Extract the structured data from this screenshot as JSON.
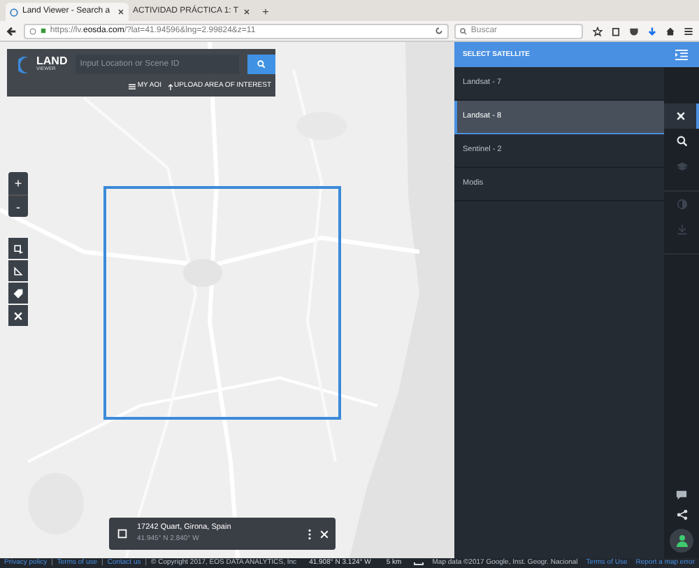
{
  "browser": {
    "tabs": [
      {
        "title": "Land Viewer - Search a",
        "selected": true
      },
      {
        "title": "ACTIVIDAD PRÁCTICA 1: T",
        "selected": false
      }
    ],
    "new_tab": "+",
    "url_prefix": "https://lv.",
    "url_domain": "eosda.com",
    "url_rest": "/?lat=41.94596&lng=2.99824&z=11",
    "search_placeholder": "Buscar"
  },
  "app": {
    "logo": {
      "line1": "LAND",
      "line2": "VIEWER"
    },
    "search": {
      "placeholder": "Input Location or Scene ID"
    },
    "links": [
      "MY AOI",
      "UPLOAD AREA OF INTEREST"
    ]
  },
  "map": {
    "kind": "picture",
    "zoom_in": "+",
    "zoom_out": "-"
  },
  "location_card": {
    "address": "17242 Quart, Girona, Spain",
    "coords": "41.945° N 2.840° W"
  },
  "satellite_panel": {
    "title": "SELECT SATELLITE",
    "items": [
      {
        "label": "Landsat - 7",
        "selected": false
      },
      {
        "label": "Landsat - 8",
        "selected": true
      },
      {
        "label": "Sentinel - 2",
        "selected": false
      },
      {
        "label": "Modis",
        "selected": false
      }
    ]
  },
  "sidebar": {
    "tools": [
      {
        "kind": "satellite",
        "selected": true,
        "disabled": false
      },
      {
        "kind": "search",
        "selected": false,
        "disabled": false
      },
      {
        "kind": "layers",
        "selected": false,
        "disabled": true
      },
      {
        "kind": "contrast",
        "selected": false,
        "disabled": true
      },
      {
        "kind": "download",
        "selected": false,
        "disabled": true
      }
    ]
  },
  "status_bar": {
    "links": [
      "Privacy policy",
      "Terms of use",
      "Contact us"
    ],
    "separator": "|",
    "copyright": "© Copyright 2017, EOS DATA ANALYTICS, Inc",
    "cursor_coords": "41.908° N 3.124° W",
    "scale": "5 km",
    "map_data": "Map data ©2017 Google, Inst. Geogr. Nacional",
    "map_links": [
      "Terms of Use",
      "Report a map error"
    ]
  }
}
